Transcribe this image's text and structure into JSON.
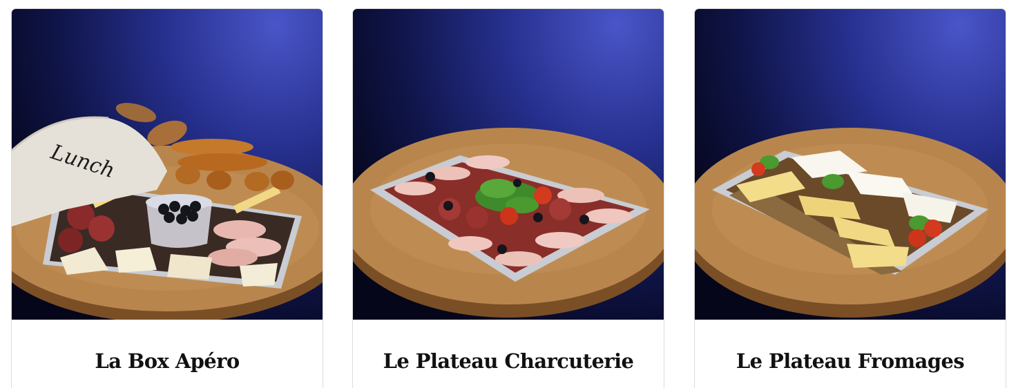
{
  "products": [
    {
      "title": "La Box Apéro",
      "image_icon": "aperitif-box-photo",
      "bag_text": "Lunch"
    },
    {
      "title": "Le Plateau Charcuterie",
      "image_icon": "charcuterie-platter-photo"
    },
    {
      "title": "Le Plateau Fromages",
      "image_icon": "cheese-platter-photo"
    }
  ],
  "colors": {
    "background_dark": "#05061a",
    "background_blue": "#2a3394",
    "table_wood": "#b8864d",
    "title_text": "#111111"
  }
}
